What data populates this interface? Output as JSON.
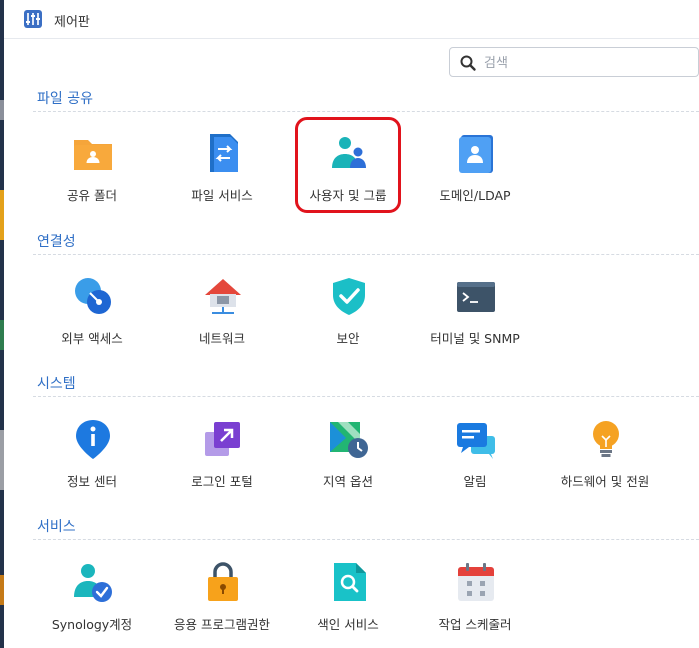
{
  "window": {
    "title": "제어판"
  },
  "search": {
    "placeholder": "검색"
  },
  "sections": [
    {
      "title": "파일 공유",
      "items": [
        {
          "label": "공유 폴더",
          "icon": "shared-folder-icon"
        },
        {
          "label": "파일 서비스",
          "icon": "file-services-icon"
        },
        {
          "label": "사용자 및 그룹",
          "icon": "user-group-icon"
        },
        {
          "label": "도메인/LDAP",
          "icon": "domain-ldap-icon"
        }
      ]
    },
    {
      "title": "연결성",
      "items": [
        {
          "label": "외부 액세스",
          "icon": "external-access-icon"
        },
        {
          "label": "네트워크",
          "icon": "network-icon"
        },
        {
          "label": "보안",
          "icon": "security-icon"
        },
        {
          "label": "터미널 및 SNMP",
          "icon": "terminal-snmp-icon"
        }
      ]
    },
    {
      "title": "시스템",
      "items": [
        {
          "label": "정보 센터",
          "icon": "info-center-icon"
        },
        {
          "label": "로그인 포털",
          "icon": "login-portal-icon"
        },
        {
          "label": "지역 옵션",
          "icon": "regional-options-icon"
        },
        {
          "label": "알림",
          "icon": "notification-icon"
        },
        {
          "label": "하드웨어 및 전원",
          "icon": "hardware-power-icon"
        }
      ]
    },
    {
      "title": "서비스",
      "items": [
        {
          "label": "Synology계정",
          "icon": "synology-account-icon"
        },
        {
          "label": "응용 프로그램권한",
          "icon": "application-privileges-icon"
        },
        {
          "label": "색인 서비스",
          "icon": "indexing-service-icon"
        },
        {
          "label": "작업 스케줄러",
          "icon": "task-scheduler-icon"
        }
      ]
    }
  ],
  "colors": {
    "accent": "#2f6fc6",
    "highlight": "#e1131c"
  }
}
